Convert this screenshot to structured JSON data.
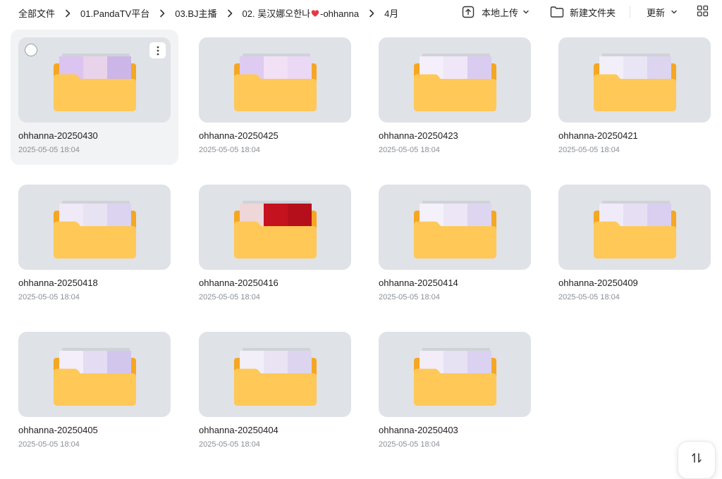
{
  "breadcrumb": {
    "items": [
      "全部文件",
      "01.PandaTV平台",
      "03.BJ主播",
      "02. 吴汉娜오한나",
      "4月"
    ],
    "heart_suffix": "-ohhanna"
  },
  "toolbar": {
    "upload_label": "本地上传",
    "new_folder_label": "新建文件夹",
    "sort_label": "更新"
  },
  "colors": {
    "folder_front": "#FFC857",
    "folder_back": "#F5A623",
    "thumb_bg": "#DFE2E6",
    "heart": "#E53945"
  },
  "folders": [
    {
      "name": "ohhanna-20250430",
      "date": "2025-05-05 18:04",
      "selected": true,
      "preview": [
        "#e8d3ea",
        "#d9c2ef",
        "#c9b2e8"
      ]
    },
    {
      "name": "ohhanna-20250425",
      "date": "2025-05-05 18:04",
      "selected": false,
      "preview": [
        "#f2e0f4",
        "#dcc9f2",
        "#e9d7f5"
      ]
    },
    {
      "name": "ohhanna-20250423",
      "date": "2025-05-05 18:04",
      "selected": false,
      "preview": [
        "#efe6f7",
        "#f4f0fb",
        "#d7c8ef"
      ]
    },
    {
      "name": "ohhanna-20250421",
      "date": "2025-05-05 18:04",
      "selected": false,
      "preview": [
        "#e9e5f5",
        "#f3f0fa",
        "#dcd2f0"
      ]
    },
    {
      "name": "ohhanna-20250418",
      "date": "2025-05-05 18:04",
      "selected": false,
      "preview": [
        "#e7e3f3",
        "#efe9f8",
        "#d9d0ef"
      ]
    },
    {
      "name": "ohhanna-20250416",
      "date": "2025-05-05 18:04",
      "selected": false,
      "preview": [
        "#c5121f",
        "#f3ecec",
        "#b3101c"
      ]
    },
    {
      "name": "ohhanna-20250414",
      "date": "2025-05-05 18:04",
      "selected": false,
      "preview": [
        "#ece6f6",
        "#f5f2fb",
        "#ddd4f0"
      ]
    },
    {
      "name": "ohhanna-20250409",
      "date": "2025-05-05 18:04",
      "selected": false,
      "preview": [
        "#e6dff4",
        "#f1ecf9",
        "#d8cdef"
      ]
    },
    {
      "name": "ohhanna-20250405",
      "date": "2025-05-05 18:04",
      "selected": false,
      "preview": [
        "#e3dcf3",
        "#f4eff9",
        "#cfc3ec"
      ]
    },
    {
      "name": "ohhanna-20250404",
      "date": "2025-05-05 18:04",
      "selected": false,
      "preview": [
        "#e9e3f4",
        "#f3eff9",
        "#dcd3ef"
      ]
    },
    {
      "name": "ohhanna-20250403",
      "date": "2025-05-05 18:04",
      "selected": false,
      "preview": [
        "#e7e1f4",
        "#f3eef9",
        "#d9cfef"
      ]
    }
  ],
  "icons": {
    "breadcrumb_separator": "chevron-right-icon",
    "upload": "upload-icon",
    "new_folder": "folder-outline-icon",
    "sort": "chevron-down-icon",
    "view": "grid-view-icon",
    "more": "more-vertical-icon",
    "sort_fab": "sort-arrows-icon"
  }
}
